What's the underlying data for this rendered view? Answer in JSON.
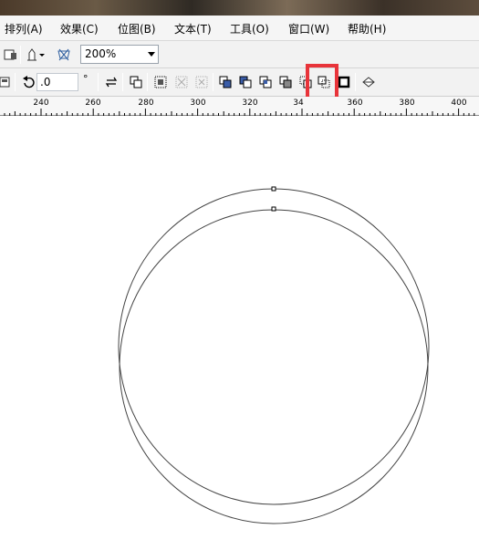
{
  "menu": {
    "items": [
      "排列(A)",
      "效果(C)",
      "位图(B)",
      "文本(T)",
      "工具(O)",
      "窗口(W)",
      "帮助(H)"
    ]
  },
  "toolbar1": {
    "zoom_value": "200%"
  },
  "toolbar2": {
    "rotation_value": ".0",
    "degree_symbol": "°"
  },
  "ruler": {
    "labels": [
      "240",
      "260",
      "280",
      "300",
      "320",
      "34",
      "360",
      "380",
      "400"
    ]
  },
  "icons": {
    "highlighted": "back-minus-front-icon"
  },
  "colors": {
    "highlight": "#e8343a",
    "shape_stroke": "#444444"
  }
}
